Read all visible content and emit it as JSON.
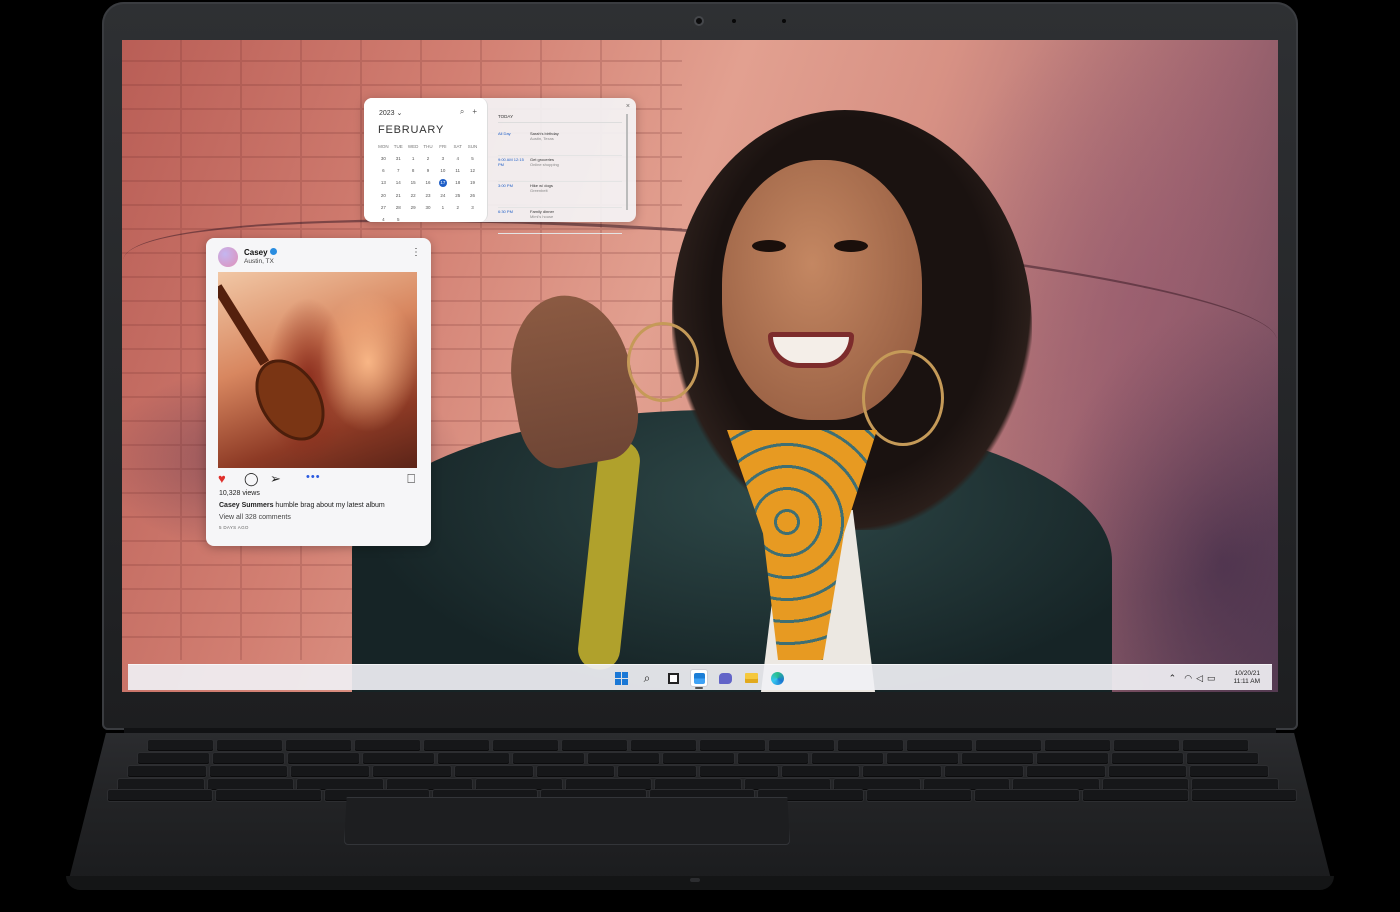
{
  "calendar": {
    "year": "2023",
    "month": "FEBRUARY",
    "weekdays": [
      "MON",
      "TUE",
      "WED",
      "THU",
      "FRI",
      "SAT",
      "SUN"
    ],
    "days": [
      "30",
      "31",
      "1",
      "2",
      "3",
      "4",
      "5",
      "6",
      "7",
      "8",
      "9",
      "10",
      "11",
      "12",
      "13",
      "14",
      "15",
      "16",
      "17",
      "18",
      "19",
      "20",
      "21",
      "22",
      "23",
      "24",
      "25",
      "26",
      "27",
      "28",
      "29",
      "30",
      "1",
      "2",
      "3",
      "4",
      "5"
    ],
    "today": "17",
    "agenda_title": "TODAY",
    "events": [
      {
        "time": "All Day",
        "title": "Sarah's birthday",
        "subtitle": "Austin, Texas"
      },
      {
        "time": "9:00 AM 12:15 PM",
        "title": "Get groceries",
        "subtitle": "Online shopping"
      },
      {
        "time": "3:00 PM",
        "title": "Hike w/ dogs",
        "subtitle": "Greenbelt"
      },
      {
        "time": "6:30 PM",
        "title": "Family dinner",
        "subtitle": "Mimi's house"
      }
    ]
  },
  "post": {
    "name": "Casey",
    "location": "Austin, TX",
    "views": "10,328 views",
    "caption_user": "Casey Summers",
    "caption_text": " humble brag about my latest album",
    "comments": "View all 328 comments",
    "ago": "5 DAYS AGO"
  },
  "taskbar": {
    "icons": [
      "windows-start-icon",
      "search-icon",
      "task-view-icon",
      "widgets-icon",
      "chat-icon",
      "file-explorer-icon",
      "edge-icon"
    ],
    "date": "10/20/21",
    "time": "11:11 AM"
  },
  "colors": {
    "accent": "#1f5fc7",
    "heart": "#e0302c",
    "taskbar": "#f0f0f4"
  }
}
